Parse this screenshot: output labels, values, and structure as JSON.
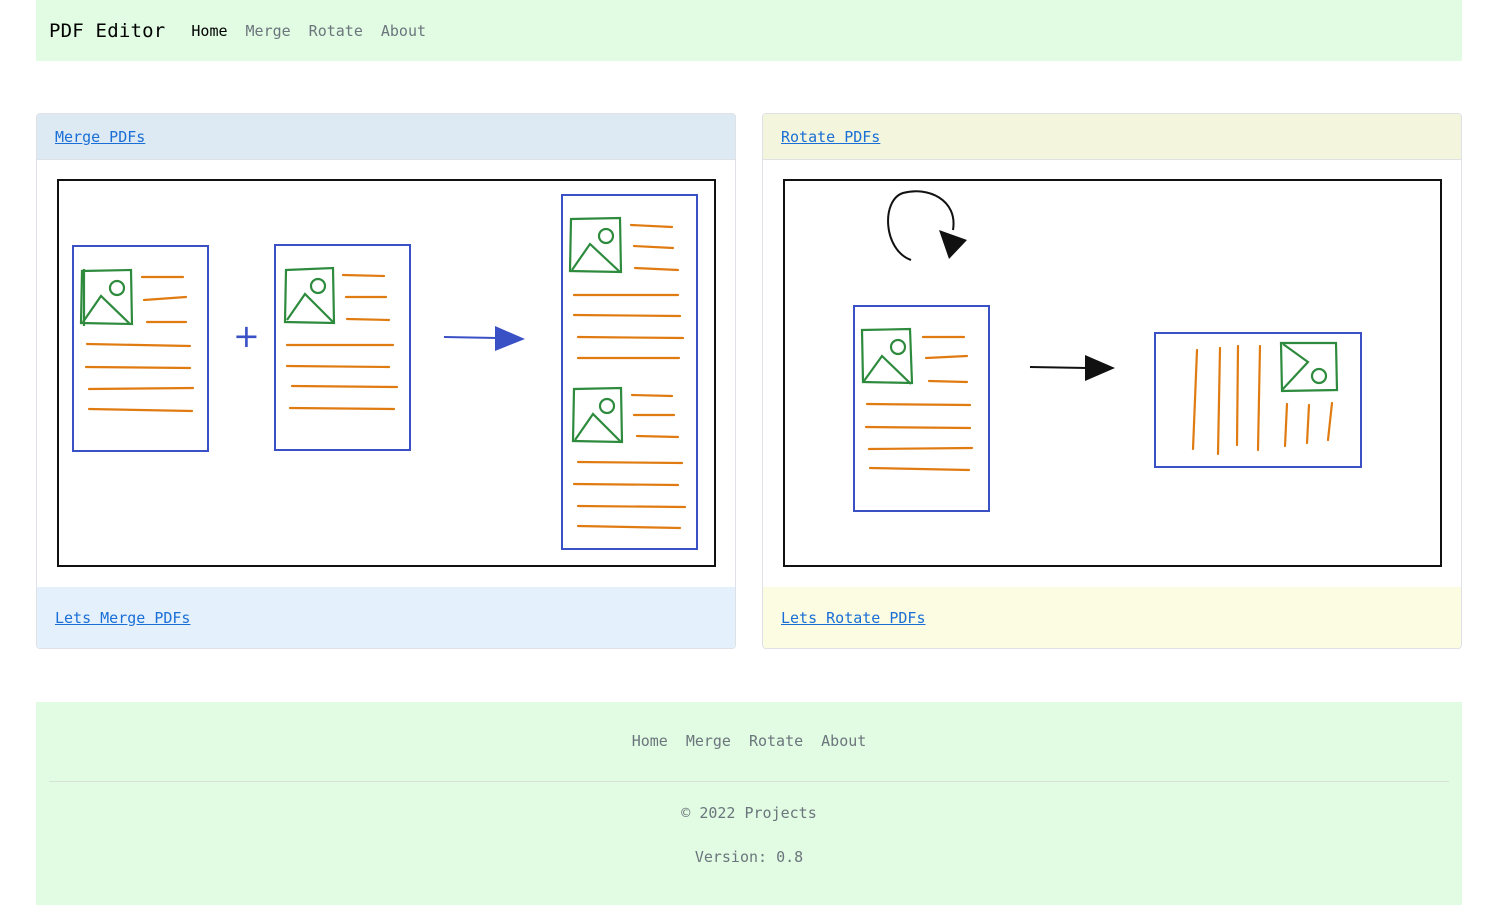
{
  "navbar": {
    "brand": "PDF Editor",
    "links": [
      "Home",
      "Merge",
      "Rotate",
      "About"
    ],
    "active": "Home"
  },
  "merge_card": {
    "header_link": "Merge PDFs",
    "footer_link": "Lets Merge PDFs",
    "colors": {
      "header_bg": "#dde9f3",
      "footer_bg": "#e4f1fc"
    }
  },
  "rotate_card": {
    "header_link": "Rotate PDFs",
    "footer_link": "Lets Rotate PDFs",
    "colors": {
      "header_bg": "#f3f5dc",
      "footer_bg": "#fcfce2"
    }
  },
  "footer": {
    "links": [
      "Home",
      "Merge",
      "Rotate",
      "About"
    ],
    "copyright": "© 2022 Projects",
    "version": "Version: 0.8"
  },
  "colors": {
    "nav_bg": "#e1fce2",
    "link": "#1a6fd6",
    "sketch_blue": "#3a51c6",
    "sketch_green": "#2e8b3e",
    "sketch_orange": "#e07b12"
  }
}
